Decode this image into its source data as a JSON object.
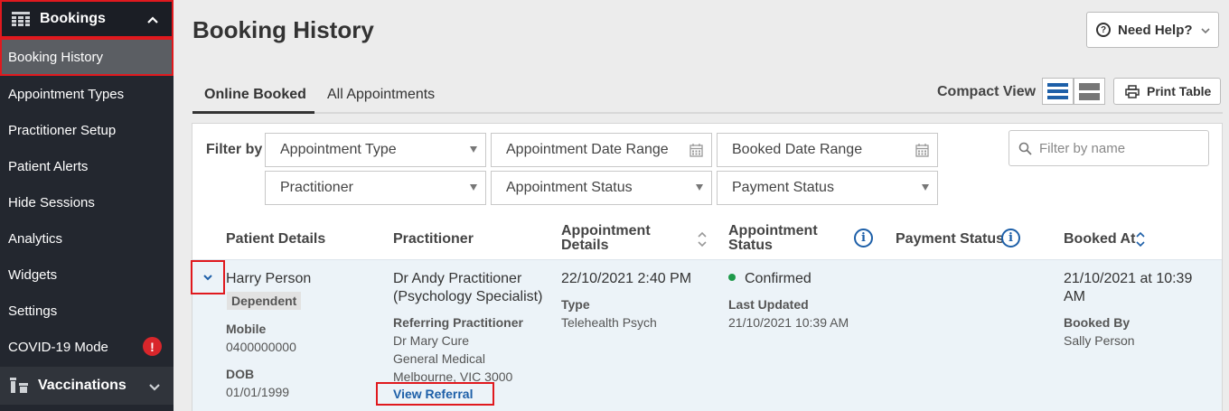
{
  "sidebar": {
    "bookings_label": "Bookings",
    "items": [
      {
        "label": "Booking History"
      },
      {
        "label": "Appointment Types"
      },
      {
        "label": "Practitioner Setup"
      },
      {
        "label": "Patient Alerts"
      },
      {
        "label": "Hide Sessions"
      },
      {
        "label": "Analytics"
      },
      {
        "label": "Widgets"
      },
      {
        "label": "Settings"
      },
      {
        "label": "COVID-19 Mode",
        "badge": "!"
      }
    ],
    "vaccinations_label": "Vaccinations"
  },
  "header": {
    "title": "Booking History",
    "help_label": "Need Help?",
    "help_icon_glyph": "?"
  },
  "tabs": [
    {
      "label": "Online Booked",
      "active": true
    },
    {
      "label": "All Appointments",
      "active": false
    }
  ],
  "view": {
    "compact_label": "Compact View",
    "print_label": "Print Table"
  },
  "filters": {
    "label": "Filter by",
    "appointment_type": "Appointment Type",
    "appointment_date_range": "Appointment Date Range",
    "booked_date_range": "Booked Date Range",
    "practitioner": "Practitioner",
    "appointment_status": "Appointment Status",
    "payment_status": "Payment Status",
    "search_placeholder": "Filter by name"
  },
  "table": {
    "headers": {
      "patient": "Patient Details",
      "practitioner": "Practitioner",
      "appointment_line1": "Appointment",
      "appointment_line2": "Details",
      "status_line1": "Appointment",
      "status_line2": "Status",
      "payment": "Payment Status",
      "booked_at": "Booked At"
    },
    "info_glyph": "i",
    "rows": [
      {
        "patient_name": "Harry Person",
        "patient_badge": "Dependent",
        "mobile_label": "Mobile",
        "mobile": "0400000000",
        "dob_label": "DOB",
        "dob": "01/01/1999",
        "practitioner_line1": "Dr Andy Practitioner",
        "practitioner_line2": "(Psychology Specialist)",
        "referring_label": "Referring Practitioner",
        "referring_name": "Dr Mary Cure",
        "referring_clinic": "General Medical",
        "referring_location": "Melbourne, VIC 3000",
        "view_referral": "View Referral",
        "appointment_datetime": "22/10/2021 2:40 PM",
        "type_label": "Type",
        "type_value": "Telehealth Psych",
        "status": "Confirmed",
        "last_updated_label": "Last Updated",
        "last_updated": "21/10/2021 10:39 AM",
        "booked_at_line1": "21/10/2021 at 10:39",
        "booked_at_line2": "AM",
        "booked_by_label": "Booked By",
        "booked_by": "Sally Person"
      }
    ]
  },
  "colors": {
    "sidebar_bg": "#23272f",
    "highlight_red": "#e0191e",
    "link_blue": "#1d5fa8",
    "status_green": "#1e9a4a",
    "row_bg": "#ecf3f8"
  }
}
